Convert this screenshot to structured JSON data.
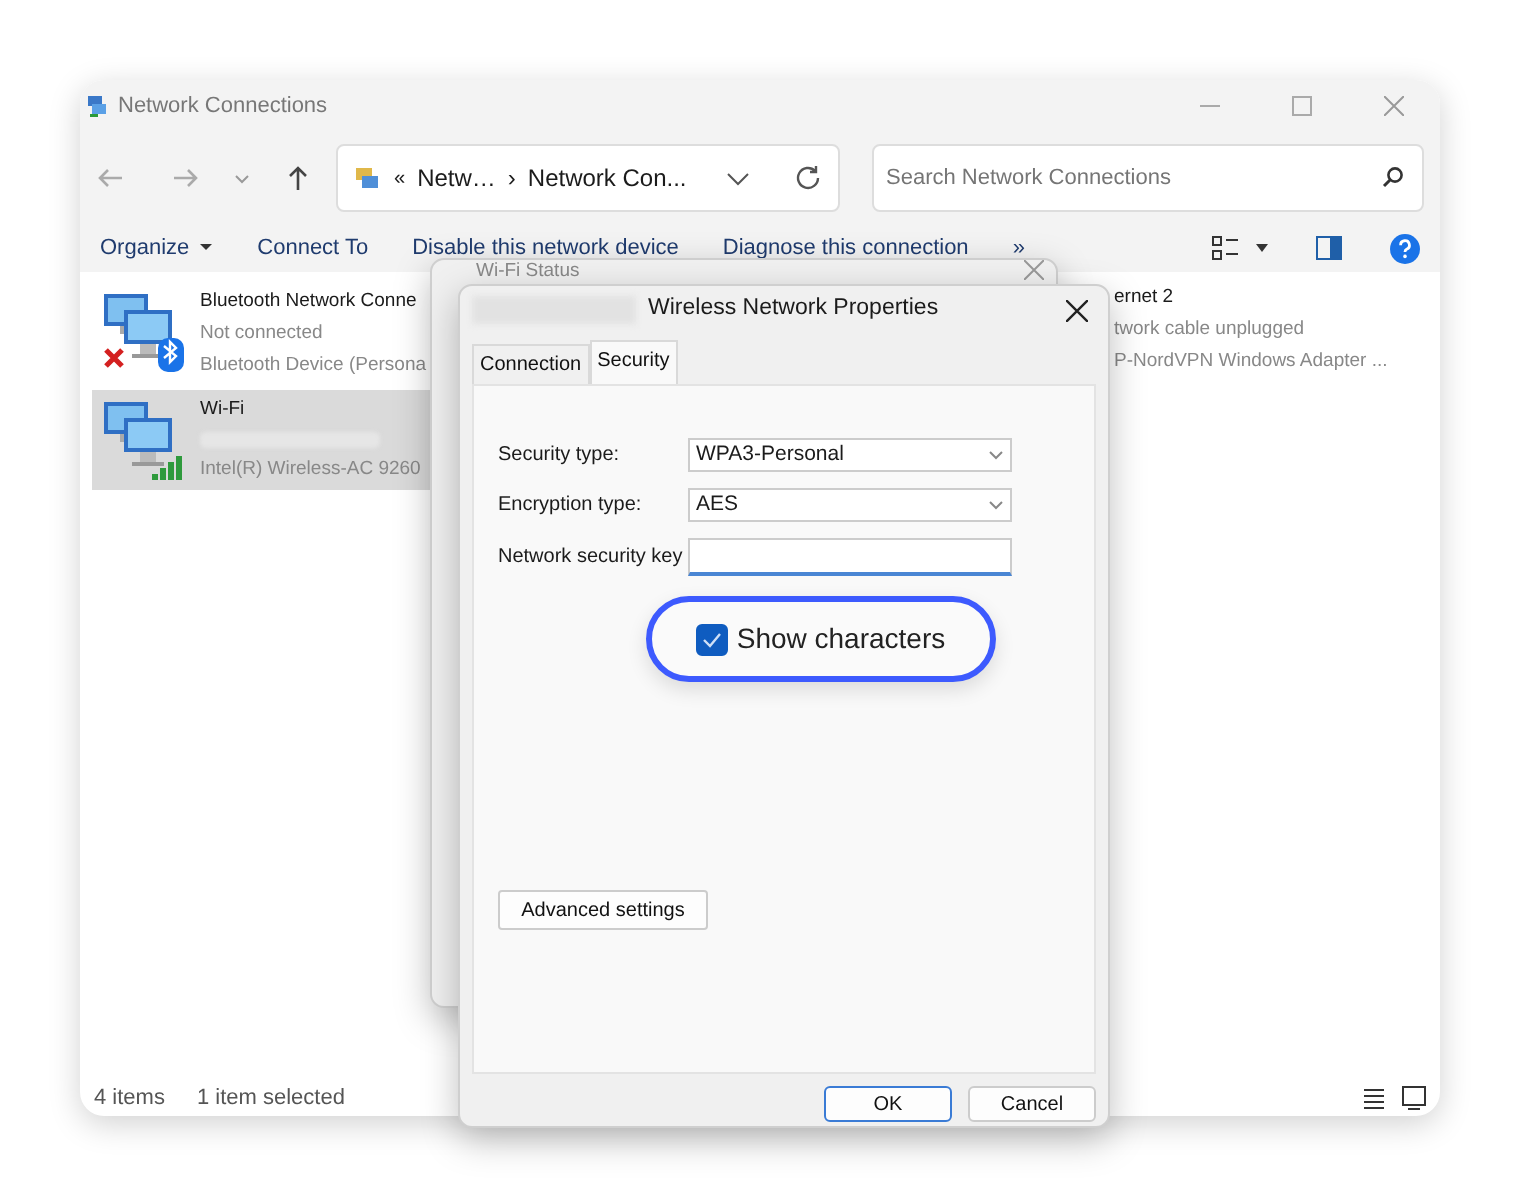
{
  "window": {
    "title": "Network Connections"
  },
  "address_bar": {
    "prefix": "«",
    "crumbs": [
      "Netw…",
      "Network Con..."
    ],
    "separator": "›"
  },
  "search": {
    "placeholder": "Search Network Connections"
  },
  "toolbar": [
    {
      "label": "Organize",
      "kind": "menu"
    },
    {
      "label": "Connect To",
      "kind": "command"
    },
    {
      "label": "Disable this network device",
      "kind": "command"
    },
    {
      "label": "Diagnose this connection",
      "kind": "command"
    },
    {
      "label": "»",
      "kind": "command"
    }
  ],
  "connections": [
    {
      "name": "Bluetooth Network Conne",
      "status": "Not connected",
      "device": "Bluetooth Device (Persona",
      "kind": "disconnected",
      "selected": false
    },
    {
      "name": "Wi-Fi",
      "status_hidden": true,
      "device": "Intel(R) Wireless-AC 9260",
      "kind": "wifi",
      "selected": true
    }
  ],
  "connections_right": [
    {
      "name": "ernet 2",
      "status": "twork cable unplugged",
      "device": "P-NordVPN Windows Adapter ..."
    }
  ],
  "status_bar": [
    "4 items",
    "1 item selected"
  ],
  "status_dialog": {
    "title": "Wi-Fi Status"
  },
  "properties_dialog": {
    "title": "Wireless Network Properties",
    "title_hidden": true,
    "tabs": [
      {
        "label": "Connection",
        "selected": false
      },
      {
        "label": "Security",
        "selected": true
      }
    ],
    "fields": [
      {
        "label": "Security type:",
        "value": "WPA3-Personal",
        "kind": "select"
      },
      {
        "label": "Encryption type:",
        "value": "AES",
        "kind": "select"
      },
      {
        "label": "Network security key",
        "kind": "text"
      }
    ],
    "show_characters": {
      "label": "Show characters",
      "checked": true,
      "highlighted": true
    },
    "advanced_button": "Advanced settings",
    "buttons": [
      {
        "label": "OK",
        "default": true
      },
      {
        "label": "Cancel",
        "default": false
      }
    ]
  }
}
